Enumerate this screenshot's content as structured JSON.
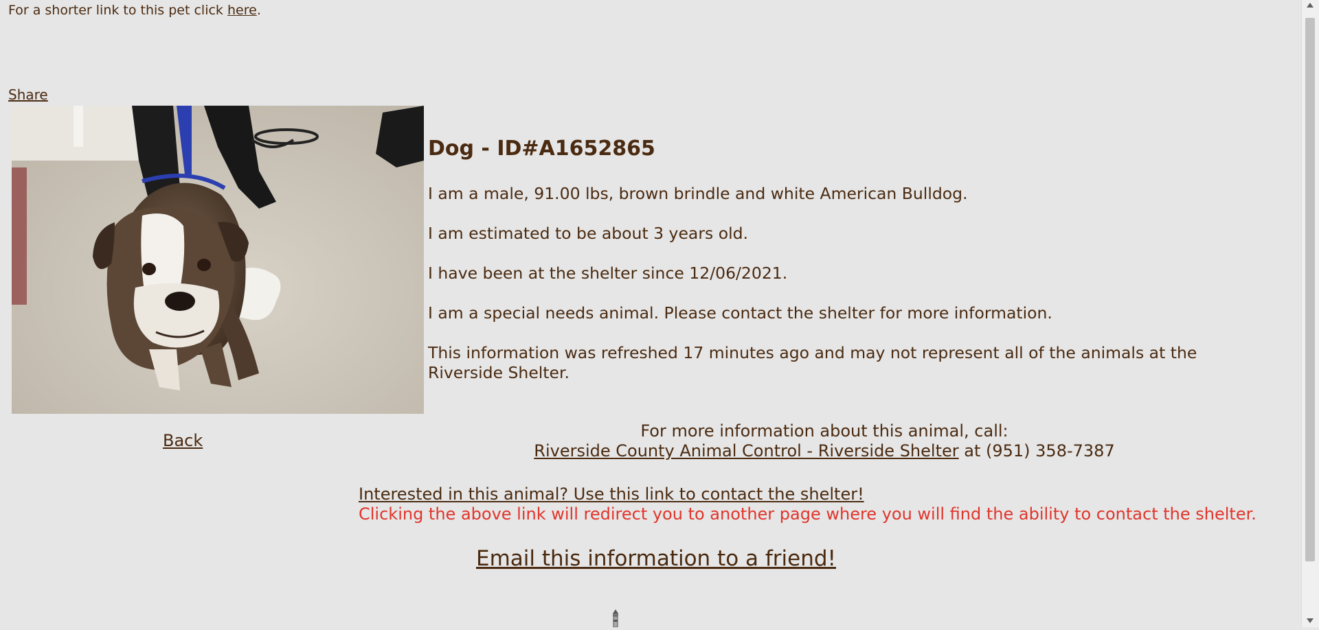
{
  "shortlink": {
    "prefix": "For a shorter link to this pet click ",
    "link_text": "here",
    "suffix": "."
  },
  "share_label": "Share",
  "photo": {
    "icon": "dog-photo"
  },
  "animal": {
    "title": "Dog - ID#A1652865",
    "description": "I am a male, 91.00 lbs, brown brindle and white American Bulldog.",
    "age": "I am estimated to be about 3 years old.",
    "since": "I have been at the shelter since 12/06/2021.",
    "special_needs": "I am a special needs animal. Please contact the shelter for more information.",
    "refreshed_line1": "This information was refreshed 17 minutes ago and may not represent all of the animals at the",
    "refreshed_line2": "Riverside Shelter."
  },
  "back_label": "Back",
  "contact": {
    "heading": "For more information about this animal, call:",
    "shelter_link": "Riverside County Animal Control - Riverside Shelter",
    "phone_text": " at (951) 358-7387"
  },
  "interested_link": "Interested in this animal? Use this link to contact the shelter!",
  "redirect_note": "Clicking the above link will redirect you to another page where you will find the ability to contact the shelter.",
  "email_link": "Email this information to a friend!",
  "colors": {
    "text": "#4a2a10",
    "warning": "#e0352b",
    "background": "#e6e6e6"
  }
}
